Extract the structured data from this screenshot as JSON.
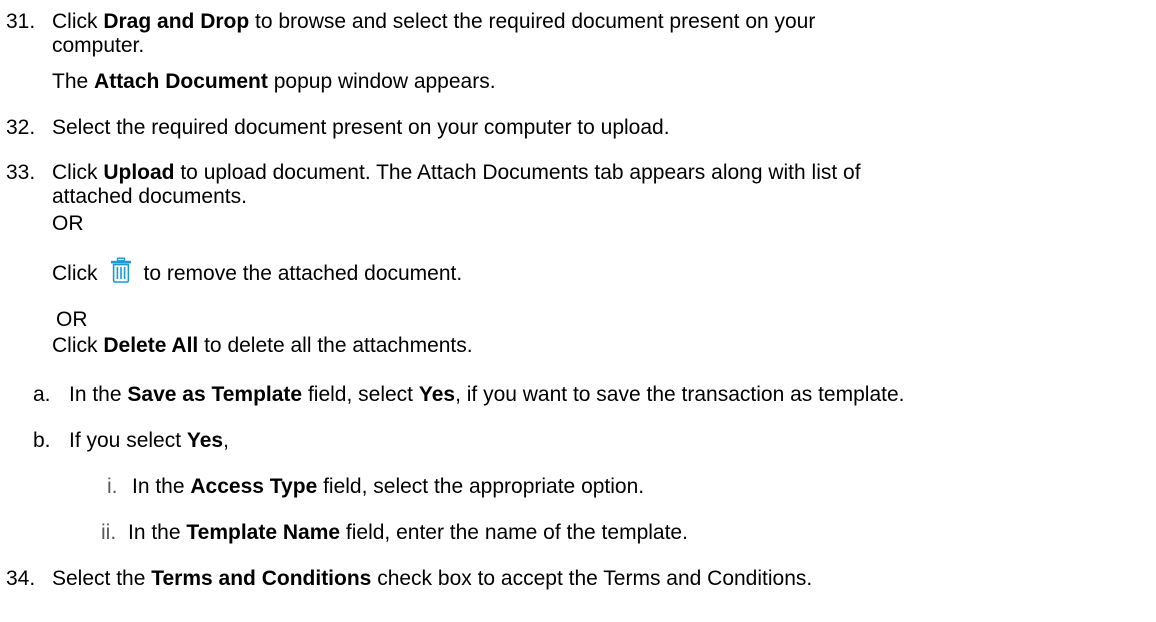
{
  "steps": [
    {
      "num": "31.",
      "line1_pre": "Click ",
      "line1_bold": "Drag and Drop",
      "line1_post": " to browse and select the required document present on your",
      "line2": "computer.",
      "line3_pre": "The ",
      "line3_bold": "Attach Document",
      "line3_post": " popup window appears."
    },
    {
      "num": "32.",
      "text": "Select the required document present on your computer to upload."
    },
    {
      "num": "33.",
      "line1_pre": "Click ",
      "line1_bold": "Upload",
      "line1_post": " to upload document. The Attach Documents tab appears along with list of",
      "line2": "attached documents.",
      "or1": "OR",
      "click_pre": "Click",
      "icon": "trash-icon",
      "click_post": "to remove the attached document.",
      "or2": "OR",
      "del_pre": "Click ",
      "del_bold": "Delete All",
      "del_post": " to delete all the attachments."
    },
    {
      "num": "34.",
      "pre": "Select the ",
      "bold": "Terms and Conditions",
      "post": " check box to accept the Terms and Conditions."
    }
  ],
  "substeps": [
    {
      "label": "a.",
      "pre": "In the ",
      "bold1": "Save as Template",
      "mid": " field, select ",
      "bold2": "Yes",
      "post": ", if you want to save the transaction as template."
    },
    {
      "label": "b.",
      "pre": "If you select ",
      "bold": "Yes",
      "post": ","
    }
  ],
  "subsubsteps": [
    {
      "label": "i.",
      "pre": "In the ",
      "bold": "Access Type",
      "post": " field, select the appropriate option."
    },
    {
      "label": "ii.",
      "pre": "In the ",
      "bold": "Template Name",
      "post": " field, enter the name of the template."
    }
  ],
  "colors": {
    "text": "#000000",
    "roman_label": "#5a5a5a",
    "icon": "#1a9ad6"
  }
}
